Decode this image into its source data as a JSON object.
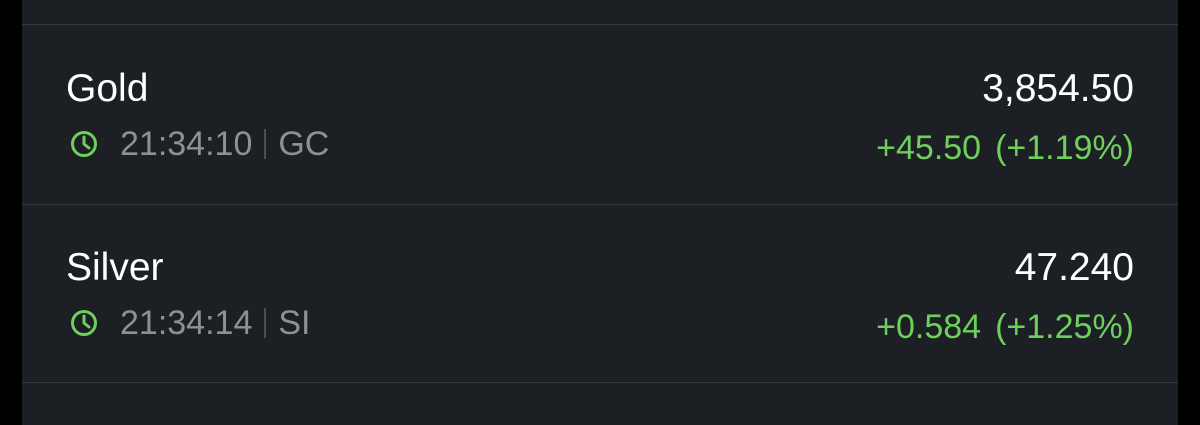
{
  "colors": {
    "background": "#1c1f23",
    "positive": "#6fcf5c",
    "muted_text": "#8e9096",
    "divider": "#34373c"
  },
  "quotes": [
    {
      "name": "Gold",
      "icon": "clock-icon",
      "time": "21:34:10",
      "symbol": "GC",
      "price": "3,854.50",
      "change": "+45.50",
      "change_pct": "(+1.19%)"
    },
    {
      "name": "Silver",
      "icon": "clock-icon",
      "time": "21:34:14",
      "symbol": "SI",
      "price": "47.240",
      "change": "+0.584",
      "change_pct": "(+1.25%)"
    }
  ]
}
